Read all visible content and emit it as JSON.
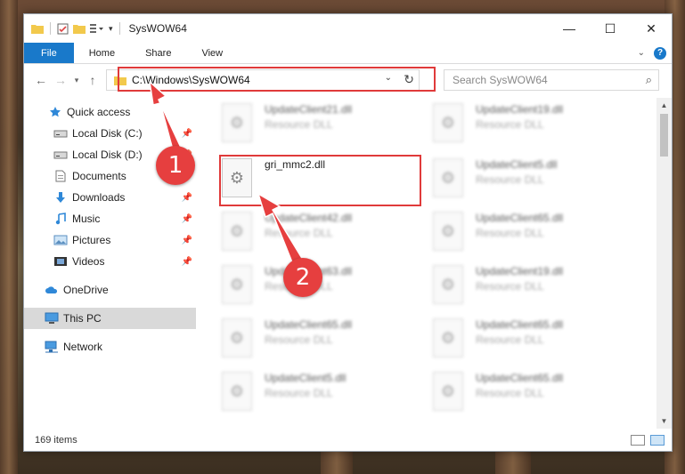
{
  "window": {
    "title": "SysWOW64",
    "controls": {
      "minimize": "—",
      "maximize": "☐",
      "close": "✕"
    }
  },
  "ribbon": {
    "tabs": [
      "File",
      "Home",
      "Share",
      "View"
    ],
    "help": "?"
  },
  "address": {
    "path": "C:\\Windows\\SysWOW64",
    "search_placeholder": "Search SysWOW64"
  },
  "nav": {
    "items": [
      {
        "label": "Quick access",
        "icon": "star-icon"
      },
      {
        "label": "Local Disk (C:)",
        "icon": "drive-icon",
        "pinned": true
      },
      {
        "label": "Local Disk (D:)",
        "icon": "drive-icon",
        "pinned": true
      },
      {
        "label": "Documents",
        "icon": "documents-icon",
        "pinned": true
      },
      {
        "label": "Downloads",
        "icon": "download-icon",
        "pinned": true
      },
      {
        "label": "Music",
        "icon": "music-icon",
        "pinned": true
      },
      {
        "label": "Pictures",
        "icon": "pictures-icon",
        "pinned": true
      },
      {
        "label": "Videos",
        "icon": "videos-icon",
        "pinned": true
      },
      {
        "label": "OneDrive",
        "icon": "cloud-icon"
      },
      {
        "label": "This PC",
        "icon": "computer-icon",
        "selected": true
      },
      {
        "label": "Network",
        "icon": "network-icon"
      }
    ]
  },
  "files": {
    "left": [
      {
        "name": "UpdateClient21.dll",
        "type": "Resource DLL"
      },
      {
        "name": "gri_mmc2.dll",
        "type": ""
      },
      {
        "name": "UpdateClient42.dll",
        "type": "Resource DLL"
      },
      {
        "name": "UpdateClient63.dll",
        "type": "Resource DLL"
      },
      {
        "name": "UpdateClient65.dll",
        "type": "Resource DLL"
      },
      {
        "name": "UpdateClient5.dll",
        "type": "Resource DLL"
      }
    ],
    "right": [
      {
        "name": "UpdateClient19.dll",
        "type": "Resource DLL"
      },
      {
        "name": "UpdateClient5.dll",
        "type": "Resource DLL"
      },
      {
        "name": "UpdateClient65.dll",
        "type": "Resource DLL"
      },
      {
        "name": "UpdateClient19.dll",
        "type": "Resource DLL"
      },
      {
        "name": "UpdateClient65.dll",
        "type": "Resource DLL"
      },
      {
        "name": "UpdateClient65.dll",
        "type": "Resource DLL"
      }
    ]
  },
  "status": {
    "count": "169 items"
  },
  "annotations": {
    "step1": "1",
    "step2": "2"
  },
  "colors": {
    "accent": "#1979ca",
    "highlight": "#e03a3a",
    "badge": "#e63f3f"
  }
}
